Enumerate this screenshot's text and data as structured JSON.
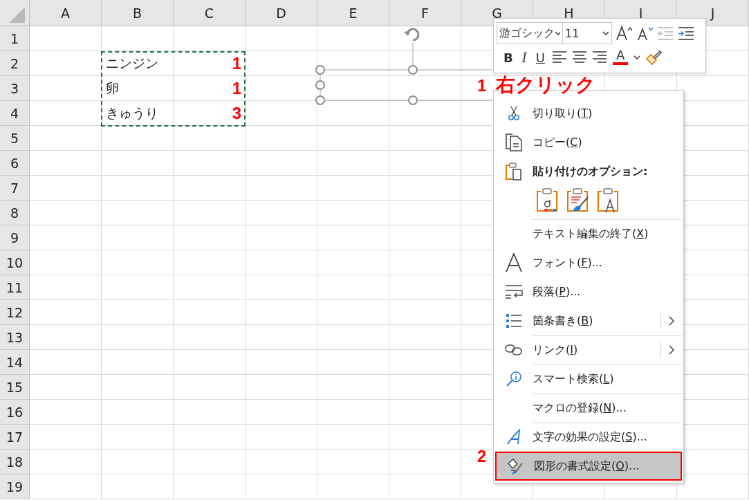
{
  "sheet": {
    "columns": [
      "A",
      "B",
      "C",
      "D",
      "E",
      "F",
      "G",
      "H",
      "I",
      "J"
    ],
    "rows": [
      "1",
      "2",
      "3",
      "4",
      "5",
      "6",
      "7",
      "8",
      "9",
      "10",
      "11",
      "12",
      "13",
      "14",
      "15",
      "16",
      "17",
      "18",
      "19"
    ],
    "data": [
      {
        "item": "ニンジン",
        "count": "1"
      },
      {
        "item": "卵",
        "count": "1"
      },
      {
        "item": "きゅうり",
        "count": "3"
      }
    ],
    "copy_marquee": true
  },
  "mini_toolbar": {
    "font": "游ゴシック",
    "size": "11",
    "bold": "B",
    "italic": "I",
    "underline": "U",
    "font_color": {
      "label": "A",
      "color": "#ff0000"
    }
  },
  "context_menu": [
    {
      "kind": "command",
      "prefix": "切り取り(",
      "key": "T",
      "rest": ")",
      "separator_before": false,
      "submenu": false,
      "selected": false
    },
    {
      "kind": "command",
      "prefix": "コピー(",
      "key": "C",
      "rest": ")",
      "separator_before": false,
      "submenu": false,
      "selected": false
    },
    {
      "kind": "heading",
      "prefix": "貼り付けのオプション:",
      "separator_before": false,
      "submenu": false,
      "selected": false
    },
    {
      "kind": "paste_icons"
    },
    {
      "kind": "command",
      "prefix": "テキスト編集の終了(",
      "key": "X",
      "rest": ")",
      "separator_before": true,
      "submenu": false,
      "selected": false
    },
    {
      "kind": "command",
      "prefix": "フォント(",
      "key": "F",
      "rest": ")...",
      "separator_before": false,
      "submenu": false,
      "selected": false
    },
    {
      "kind": "command",
      "prefix": "段落(",
      "key": "P",
      "rest": ")...",
      "separator_before": false,
      "submenu": false,
      "selected": false
    },
    {
      "kind": "command",
      "prefix": "箇条書き(",
      "key": "B",
      "rest": ")",
      "separator_before": false,
      "submenu": true,
      "selected": false
    },
    {
      "kind": "command",
      "prefix": "リンク(",
      "key": "I",
      "rest": ")",
      "separator_before": true,
      "submenu": true,
      "selected": false
    },
    {
      "kind": "command",
      "prefix": "スマート検索(",
      "key": "L",
      "rest": ")",
      "separator_before": true,
      "submenu": false,
      "selected": false
    },
    {
      "kind": "command",
      "prefix": "マクロの登録(",
      "key": "N",
      "rest": ")...",
      "separator_before": true,
      "submenu": false,
      "selected": false
    },
    {
      "kind": "command",
      "prefix": "文字の効果の設定(",
      "key": "S",
      "rest": ")...",
      "separator_before": true,
      "submenu": false,
      "selected": false
    },
    {
      "kind": "command",
      "prefix": "図形の書式設定(",
      "key": "O",
      "rest": ")...",
      "separator_before": false,
      "submenu": false,
      "selected": true
    }
  ],
  "annotations": [
    {
      "number": "1",
      "text": "右クリック"
    },
    {
      "number": "2"
    }
  ]
}
